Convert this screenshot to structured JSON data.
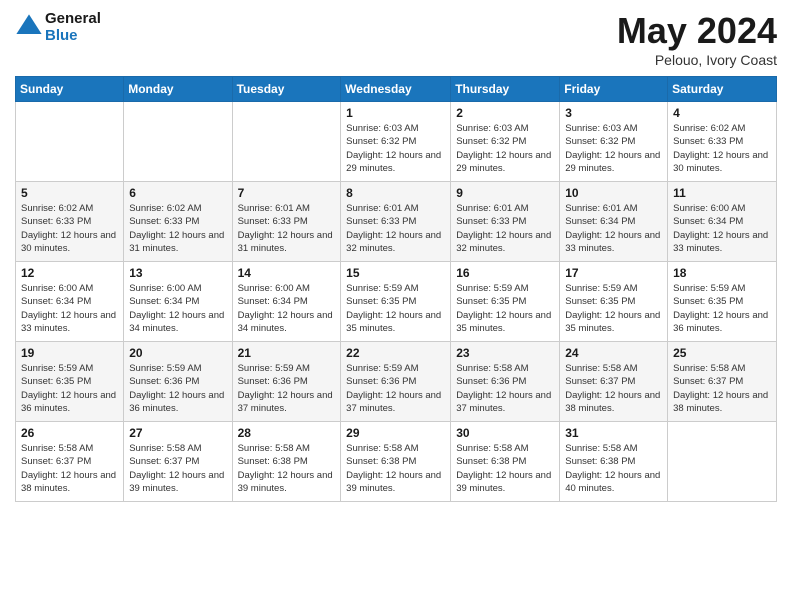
{
  "header": {
    "logo_line1": "General",
    "logo_line2": "Blue",
    "title": "May 2024",
    "location": "Pelouo, Ivory Coast"
  },
  "days_of_week": [
    "Sunday",
    "Monday",
    "Tuesday",
    "Wednesday",
    "Thursday",
    "Friday",
    "Saturday"
  ],
  "weeks": [
    [
      {
        "day": "",
        "info": ""
      },
      {
        "day": "",
        "info": ""
      },
      {
        "day": "",
        "info": ""
      },
      {
        "day": "1",
        "info": "Sunrise: 6:03 AM\nSunset: 6:32 PM\nDaylight: 12 hours and 29 minutes."
      },
      {
        "day": "2",
        "info": "Sunrise: 6:03 AM\nSunset: 6:32 PM\nDaylight: 12 hours and 29 minutes."
      },
      {
        "day": "3",
        "info": "Sunrise: 6:03 AM\nSunset: 6:32 PM\nDaylight: 12 hours and 29 minutes."
      },
      {
        "day": "4",
        "info": "Sunrise: 6:02 AM\nSunset: 6:33 PM\nDaylight: 12 hours and 30 minutes."
      }
    ],
    [
      {
        "day": "5",
        "info": "Sunrise: 6:02 AM\nSunset: 6:33 PM\nDaylight: 12 hours and 30 minutes."
      },
      {
        "day": "6",
        "info": "Sunrise: 6:02 AM\nSunset: 6:33 PM\nDaylight: 12 hours and 31 minutes."
      },
      {
        "day": "7",
        "info": "Sunrise: 6:01 AM\nSunset: 6:33 PM\nDaylight: 12 hours and 31 minutes."
      },
      {
        "day": "8",
        "info": "Sunrise: 6:01 AM\nSunset: 6:33 PM\nDaylight: 12 hours and 32 minutes."
      },
      {
        "day": "9",
        "info": "Sunrise: 6:01 AM\nSunset: 6:33 PM\nDaylight: 12 hours and 32 minutes."
      },
      {
        "day": "10",
        "info": "Sunrise: 6:01 AM\nSunset: 6:34 PM\nDaylight: 12 hours and 33 minutes."
      },
      {
        "day": "11",
        "info": "Sunrise: 6:00 AM\nSunset: 6:34 PM\nDaylight: 12 hours and 33 minutes."
      }
    ],
    [
      {
        "day": "12",
        "info": "Sunrise: 6:00 AM\nSunset: 6:34 PM\nDaylight: 12 hours and 33 minutes."
      },
      {
        "day": "13",
        "info": "Sunrise: 6:00 AM\nSunset: 6:34 PM\nDaylight: 12 hours and 34 minutes."
      },
      {
        "day": "14",
        "info": "Sunrise: 6:00 AM\nSunset: 6:34 PM\nDaylight: 12 hours and 34 minutes."
      },
      {
        "day": "15",
        "info": "Sunrise: 5:59 AM\nSunset: 6:35 PM\nDaylight: 12 hours and 35 minutes."
      },
      {
        "day": "16",
        "info": "Sunrise: 5:59 AM\nSunset: 6:35 PM\nDaylight: 12 hours and 35 minutes."
      },
      {
        "day": "17",
        "info": "Sunrise: 5:59 AM\nSunset: 6:35 PM\nDaylight: 12 hours and 35 minutes."
      },
      {
        "day": "18",
        "info": "Sunrise: 5:59 AM\nSunset: 6:35 PM\nDaylight: 12 hours and 36 minutes."
      }
    ],
    [
      {
        "day": "19",
        "info": "Sunrise: 5:59 AM\nSunset: 6:35 PM\nDaylight: 12 hours and 36 minutes."
      },
      {
        "day": "20",
        "info": "Sunrise: 5:59 AM\nSunset: 6:36 PM\nDaylight: 12 hours and 36 minutes."
      },
      {
        "day": "21",
        "info": "Sunrise: 5:59 AM\nSunset: 6:36 PM\nDaylight: 12 hours and 37 minutes."
      },
      {
        "day": "22",
        "info": "Sunrise: 5:59 AM\nSunset: 6:36 PM\nDaylight: 12 hours and 37 minutes."
      },
      {
        "day": "23",
        "info": "Sunrise: 5:58 AM\nSunset: 6:36 PM\nDaylight: 12 hours and 37 minutes."
      },
      {
        "day": "24",
        "info": "Sunrise: 5:58 AM\nSunset: 6:37 PM\nDaylight: 12 hours and 38 minutes."
      },
      {
        "day": "25",
        "info": "Sunrise: 5:58 AM\nSunset: 6:37 PM\nDaylight: 12 hours and 38 minutes."
      }
    ],
    [
      {
        "day": "26",
        "info": "Sunrise: 5:58 AM\nSunset: 6:37 PM\nDaylight: 12 hours and 38 minutes."
      },
      {
        "day": "27",
        "info": "Sunrise: 5:58 AM\nSunset: 6:37 PM\nDaylight: 12 hours and 39 minutes."
      },
      {
        "day": "28",
        "info": "Sunrise: 5:58 AM\nSunset: 6:38 PM\nDaylight: 12 hours and 39 minutes."
      },
      {
        "day": "29",
        "info": "Sunrise: 5:58 AM\nSunset: 6:38 PM\nDaylight: 12 hours and 39 minutes."
      },
      {
        "day": "30",
        "info": "Sunrise: 5:58 AM\nSunset: 6:38 PM\nDaylight: 12 hours and 39 minutes."
      },
      {
        "day": "31",
        "info": "Sunrise: 5:58 AM\nSunset: 6:38 PM\nDaylight: 12 hours and 40 minutes."
      },
      {
        "day": "",
        "info": ""
      }
    ]
  ]
}
